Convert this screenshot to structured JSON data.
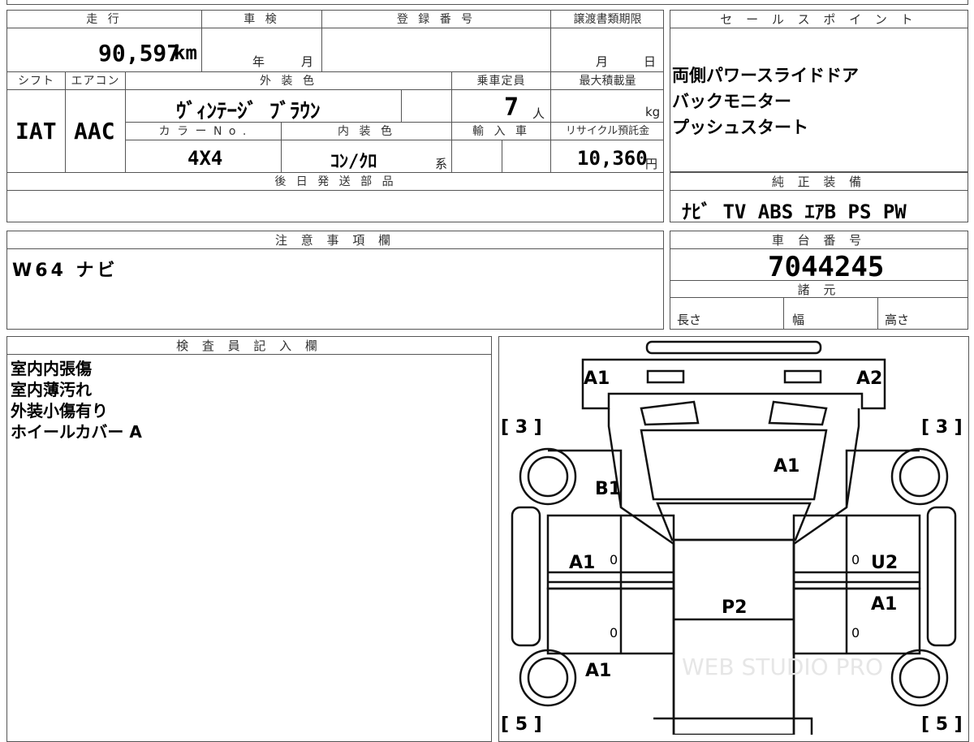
{
  "top_table": {
    "mileage_label": "走 行",
    "shaken_label": "車 検",
    "reg_label": "登 録 番 号",
    "transfer_label": "譲渡書類期限",
    "mileage_value": "90,597",
    "mileage_unit": "km",
    "shaken_year": "年",
    "shaken_month": "月",
    "transfer_month": "月",
    "transfer_day": "日",
    "shift_label": "シフト",
    "ac_label": "エアコン",
    "exterior_label": "外 装 色",
    "capacity_label": "乗車定員",
    "maxload_label": "最大積載量",
    "shift_value": "IAT",
    "ac_value": "AAC",
    "exterior_value": "ｳﾞｨﾝﾃｰｼﾞ ﾌﾞﾗｳﾝ",
    "capacity_value": "7",
    "capacity_unit": "人",
    "maxload_unit": "kg",
    "color_no_label": "カ ラ ー N o .",
    "interior_label": "内 装 色",
    "import_label": "輸 入 車",
    "recycle_label": "リサイクル預託金",
    "color_no_value": "4X4",
    "interior_value": "ｺﾝ/ｸﾛ",
    "interior_suffix": "系",
    "recycle_value": "10,360",
    "recycle_unit": "円",
    "later_parts_label": "後 日 発 送 部 品"
  },
  "sales_points": {
    "label": "セ ー ル ス ポ イ ン ト",
    "items": [
      "両側パワースライドドア",
      "バックモニター",
      "プッシュスタート"
    ]
  },
  "equipment": {
    "label": "純 正 装 備",
    "value": "ﾅﾋﾞ TV ABS ｴｱB PS PW"
  },
  "notes": {
    "label": "注 意 事 項 欄",
    "value": "W64 ナビ"
  },
  "chassis": {
    "label": "車 台 番 号",
    "value": "7044245",
    "spec_label": "諸 元",
    "length_label": "長さ",
    "width_label": "幅",
    "height_label": "高さ"
  },
  "inspector": {
    "label": "検 査 員 記 入 欄",
    "lines": [
      "室内内張傷",
      "室内薄汚れ",
      "外装小傷有り",
      "ホイールカバー A"
    ]
  },
  "diagram": {
    "marks": {
      "front_left": "A1",
      "front_right": "A2",
      "hood": "A1",
      "fender_left": "B1",
      "front_door_left": "A1",
      "front_door_right": "U2",
      "rear_door_right": "A1",
      "roof": "P2",
      "rear_fender_left": "A1"
    },
    "tire_front_left": "[ 3 ]",
    "tire_front_right": "[ 3 ]",
    "tire_rear_left": "[ 5 ]",
    "tire_rear_right": "[ 5 ]",
    "zero": "0"
  },
  "watermark": "WEB STUDIO PRO"
}
